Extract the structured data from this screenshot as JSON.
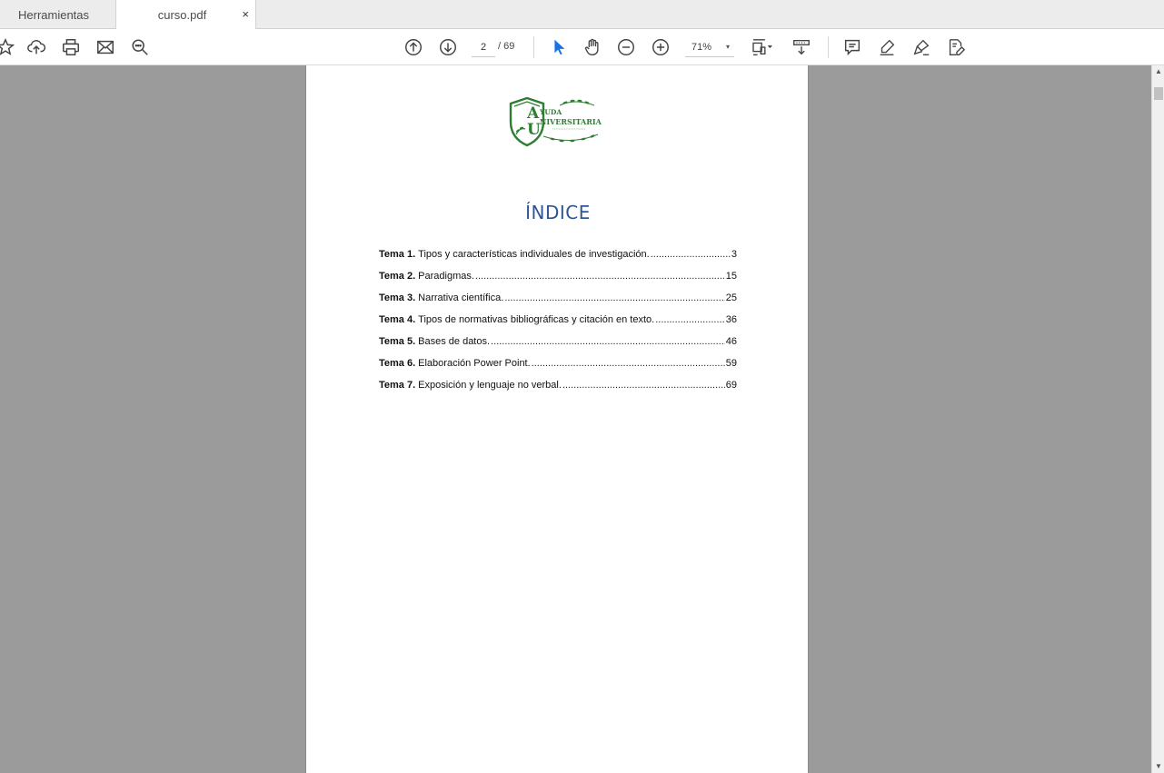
{
  "tabs": {
    "tools_label": "Herramientas",
    "doc_label": "curso.pdf",
    "close_glyph": "×"
  },
  "toolbar": {
    "icons_left": [
      "star-icon",
      "cloud-upload-icon",
      "print-icon",
      "email-icon",
      "search-zoom-icon"
    ],
    "icons_nav": [
      "page-up-icon",
      "page-down-icon"
    ],
    "current_page": "2",
    "total_pages": "/ 69",
    "icons_tools": [
      "select-cursor-icon",
      "hand-icon",
      "zoom-out-icon",
      "zoom-in-icon"
    ],
    "zoom_value": "71%",
    "zoom_caret": "▾",
    "icons_right": [
      "fit-page-icon",
      "scroll-mode-icon",
      "comment-icon",
      "highlight-icon",
      "sign-icon",
      "edit-pdf-icon"
    ],
    "accent_color": "#1473e6"
  },
  "document": {
    "logo_text_top": "YUDA",
    "logo_text_main": "NIVERSITARIA",
    "logo_letters": "AU",
    "logo_color": "#2e7d32",
    "title": "ÍNDICE",
    "title_color": "#2f5597",
    "toc": [
      {
        "label": "Tema 1.",
        "text": "Tipos y características individuales de investigación.",
        "page": "3"
      },
      {
        "label": "Tema 2.",
        "text": "Paradigmas.",
        "page": "15"
      },
      {
        "label": "Tema 3.",
        "text": "Narrativa científica.",
        "page": "25"
      },
      {
        "label": "Tema 4.",
        "text": "Tipos de normativas bibliográficas y citación en texto.",
        "page": "36"
      },
      {
        "label": "Tema 5.",
        "text": "Bases de datos.",
        "page": "46"
      },
      {
        "label": "Tema 6.",
        "text": "Elaboración Power Point.",
        "page": "59"
      },
      {
        "label": "Tema 7.",
        "text": "Exposición y lenguaje no verbal.",
        "page": "69"
      }
    ]
  },
  "scrollbar": {
    "up_glyph": "▲",
    "down_glyph": "▼"
  }
}
